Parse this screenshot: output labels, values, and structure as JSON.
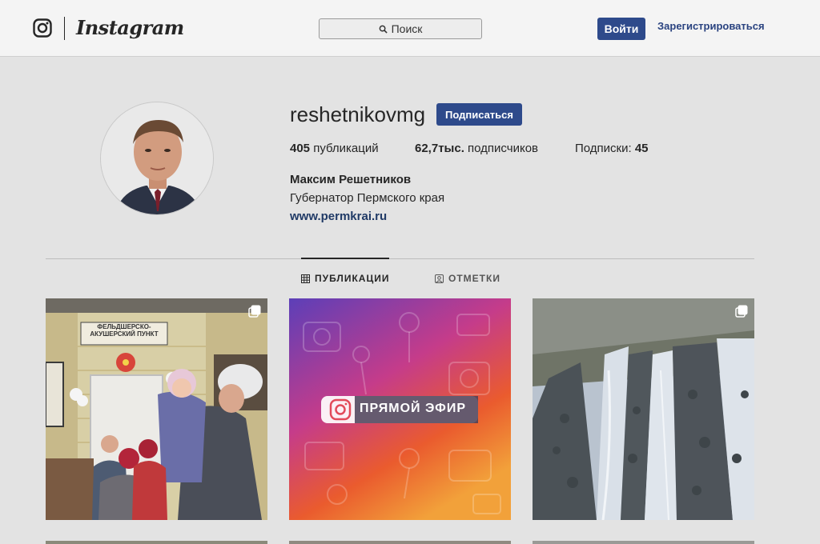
{
  "header": {
    "logo_icon": "instagram-camera-icon",
    "brand": "Instagram",
    "search": {
      "icon": "search-icon",
      "placeholder": "Поиск"
    },
    "login_label": "Войти",
    "register_label": "Зарегистрироваться"
  },
  "profile": {
    "username": "reshetnikovmg",
    "follow_label": "Подписаться",
    "stats": {
      "posts_count": "405",
      "posts_label": "публикаций",
      "followers_count": "62,7тыс.",
      "followers_label": "подписчиков",
      "following_label": "Подписки:",
      "following_count": "45"
    },
    "full_name": "Максим Решетников",
    "bio": "Губернатор Пермского края",
    "website": "www.permkrai.ru"
  },
  "tabs": [
    {
      "label": "ПУБЛИКАЦИИ",
      "icon": "grid-icon",
      "active": true
    },
    {
      "label": "ОТМЕТКИ",
      "icon": "tagged-photo-icon",
      "active": false
    }
  ],
  "posts": [
    {
      "sign_text": "ФЕЛЬДШЕРСКО-АКУШЕРСКИЙ ПУНКТ",
      "multi": true
    },
    {
      "live_badge": "ПРЯМОЙ ЭФИР",
      "multi": false
    },
    {
      "multi": true
    }
  ],
  "colors": {
    "accent": "#2e4a8b",
    "link": "#2a4380",
    "page_bg": "#e3e3e3",
    "header_bg": "#f4f4f4"
  }
}
